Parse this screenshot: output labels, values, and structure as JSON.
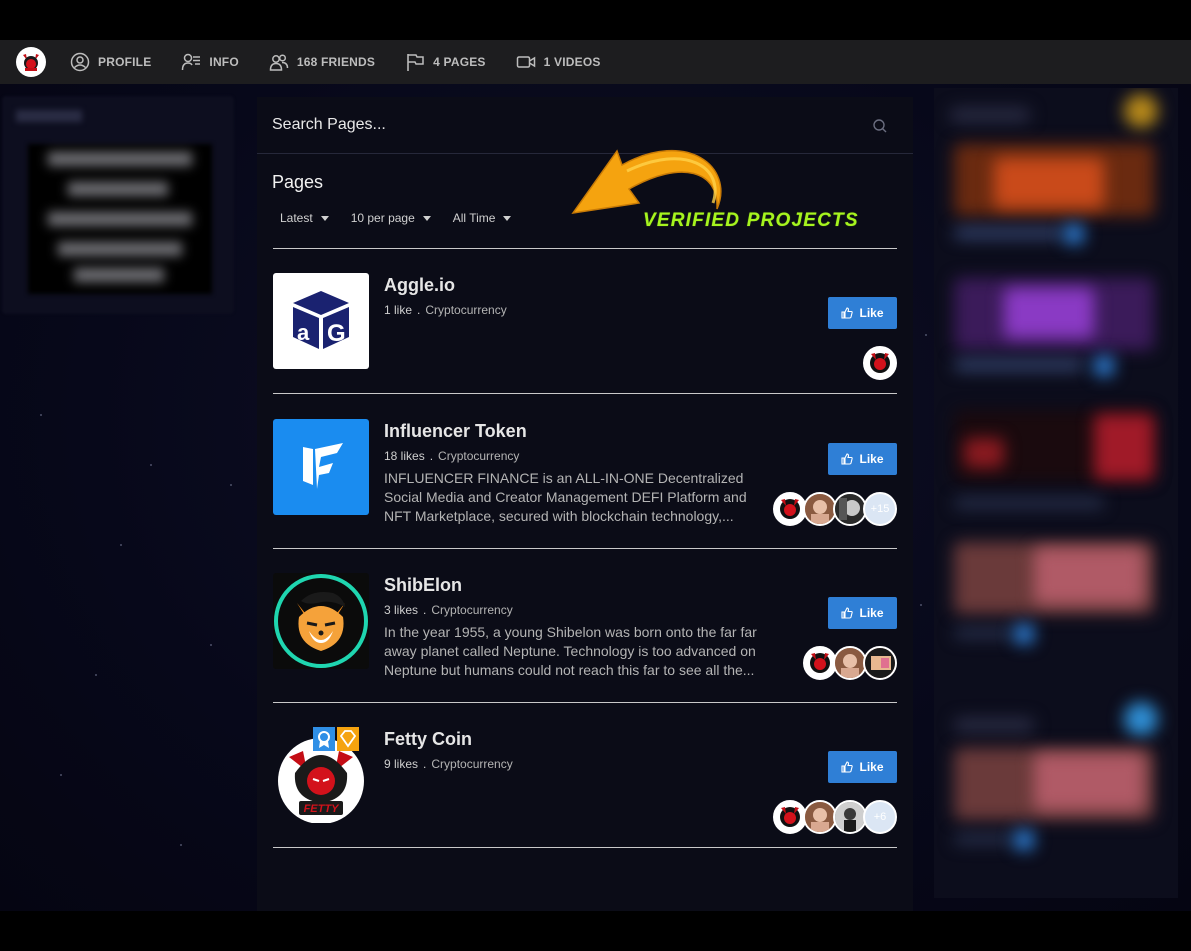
{
  "nav": {
    "items": [
      {
        "label": "PROFILE",
        "icon": "user-circle-icon"
      },
      {
        "label": "INFO",
        "icon": "user-info-icon"
      },
      {
        "label": "168 FRIENDS",
        "icon": "friends-icon"
      },
      {
        "label": "4 PAGES",
        "icon": "flag-icon"
      },
      {
        "label": "1 VIDEOS",
        "icon": "video-camera-icon"
      }
    ]
  },
  "search": {
    "placeholder": "Search Pages..."
  },
  "section": {
    "title": "Pages"
  },
  "filters": {
    "sort": "Latest",
    "per_page": "10 per page",
    "time": "All Time"
  },
  "annotation": {
    "text": "VERIFIED PROJECTS",
    "color": "#a6f41f",
    "arrow_color": "#f5a30f"
  },
  "like_label": "Like",
  "pages": [
    {
      "name": "Aggle.io",
      "likes": "1 like",
      "category": "Cryptocurrency",
      "description": "",
      "thumb": "aggle-logo",
      "extra_likers": ""
    },
    {
      "name": "Influencer Token",
      "likes": "18 likes",
      "category": "Cryptocurrency",
      "description": "INFLUENCER FINANCE is an ALL-IN-ONE Decentralized Social Media and Creator Management DEFI Platform and NFT Marketplace, secured with blockchain technology,...",
      "thumb": "influencer-logo",
      "extra_likers": "+15"
    },
    {
      "name": "ShibElon",
      "likes": "3 likes",
      "category": "Cryptocurrency",
      "description": "In the year 1955, a young Shibelon was born onto the far far away planet called Neptune. Technology is too advanced on Neptune but humans could not reach this far to see all the...",
      "thumb": "shibelon-logo",
      "extra_likers": ""
    },
    {
      "name": "Fetty Coin",
      "likes": "9 likes",
      "category": "Cryptocurrency",
      "description": "",
      "thumb": "fetty-logo",
      "extra_likers": "+6"
    }
  ],
  "colors": {
    "accent": "#2f7fd6",
    "panel": "#0b0c17",
    "navbar": "#1d1d1f"
  }
}
